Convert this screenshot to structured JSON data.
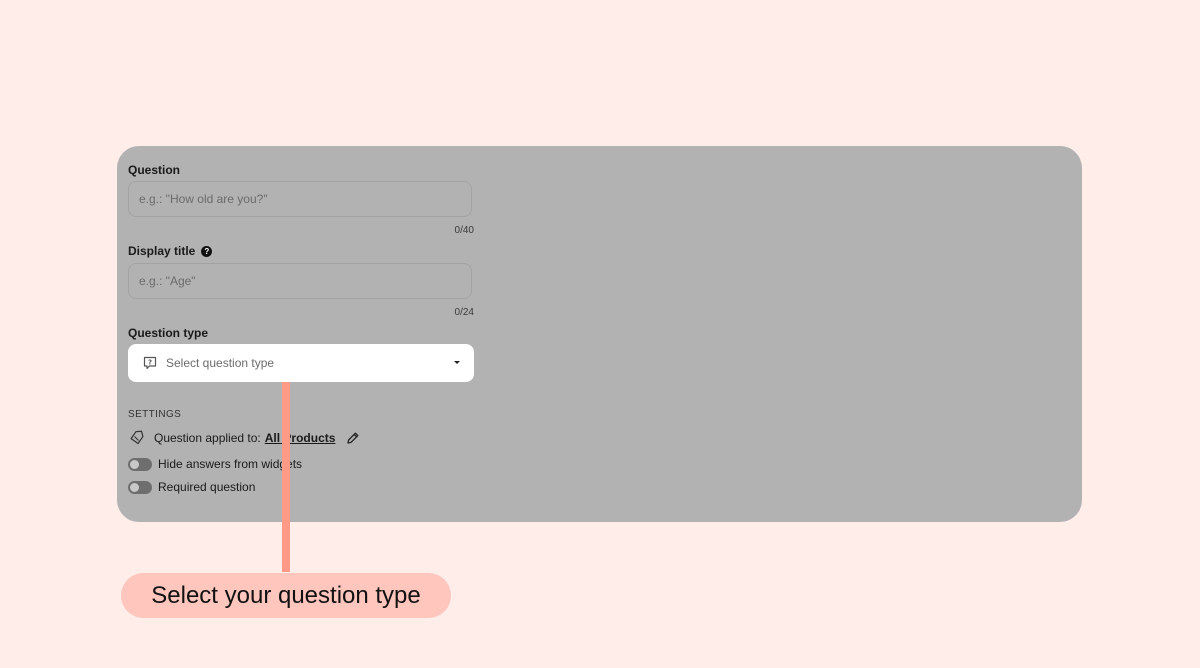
{
  "form": {
    "question": {
      "label": "Question",
      "placeholder": "e.g.: \"How old are you?\"",
      "counter": "0/40"
    },
    "display_title": {
      "label": "Display title",
      "help_icon": "question-circle-icon",
      "placeholder": "e.g.: \"Age\"",
      "counter": "0/24"
    },
    "question_type": {
      "label": "Question type",
      "placeholder": "Select question type",
      "icon": "question-bubble-icon"
    }
  },
  "settings": {
    "heading": "SETTINGS",
    "applied_prefix": "Question applied to:",
    "applied_link": "All Products",
    "hide_answers_label": "Hide answers from widgets",
    "hide_answers_on": false,
    "required_label": "Required question",
    "required_on": false
  },
  "callout": {
    "text": "Select your question type"
  },
  "colors": {
    "background": "#ffedea",
    "overlay": "#b2b2b2",
    "pointer": "#ff9a86",
    "callout_bg": "#ffc6bd"
  }
}
